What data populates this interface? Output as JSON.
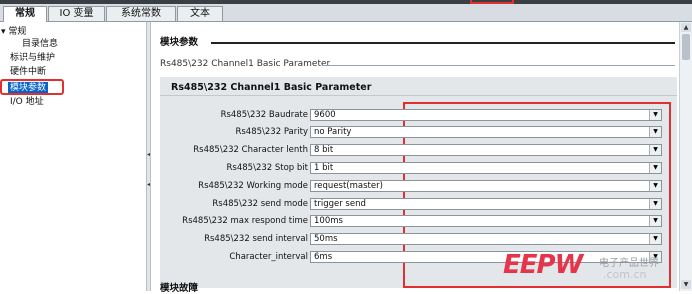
{
  "tabs": [
    {
      "label": "常规"
    },
    {
      "label": "IO 变量"
    },
    {
      "label": "系统常数"
    },
    {
      "label": "文本"
    }
  ],
  "nav": {
    "root": "常规",
    "items": [
      {
        "label": "目录信息"
      },
      {
        "label": "标识与维护"
      },
      {
        "label": "硬件中断"
      },
      {
        "label": "模块参数"
      },
      {
        "label": "I/O 地址"
      }
    ]
  },
  "main": {
    "section_title": "模块参数",
    "subsection_title": "Rs485\\232 Channel1 Basic Parameter",
    "panel_title": "Rs485\\232 Channel1 Basic Parameter",
    "params": [
      {
        "label": "Rs485\\232  Baudrate",
        "value": "9600"
      },
      {
        "label": "Rs485\\232  Parity",
        "value": "no Parity"
      },
      {
        "label": "Rs485\\232  Character lenth",
        "value": "8 bit"
      },
      {
        "label": "Rs485\\232 Stop bit",
        "value": "1 bit"
      },
      {
        "label": "Rs485\\232 Working mode",
        "value": "request(master)"
      },
      {
        "label": "Rs485\\232 send mode",
        "value": "trigger send"
      },
      {
        "label": "Rs485\\232 max respond time",
        "value": "100ms"
      },
      {
        "label": "Rs485\\232 send interval",
        "value": "50ms"
      },
      {
        "label": "Character_interval",
        "value": "6ms"
      }
    ],
    "next_section_title": "模块故障"
  },
  "watermark": {
    "logo": "EEPW",
    "tagline": "电子产品世界",
    "domain": ".com.cn"
  },
  "colors": {
    "highlight": "#e03030",
    "selected_nav": "#0a64c8",
    "panel": "#e4e7ea",
    "watermark": "#e5354a"
  }
}
